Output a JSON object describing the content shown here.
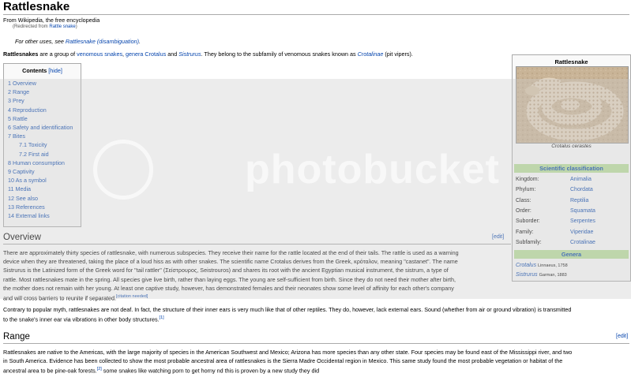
{
  "article": {
    "title": "Rattlesnake",
    "from": "From Wikipedia, the free encyclopedia",
    "redirect_prefix": "(Redirected from ",
    "redirect_link": "Rattle snake",
    "redirect_suffix": ")",
    "hatnote_prefix": "For other uses, see ",
    "hatnote_link": "Rattlesnake (disambiguation)",
    "hatnote_suffix": "."
  },
  "intro": {
    "bold": "Rattlesnakes",
    "t1": " are a group of ",
    "l1": "venomous snakes",
    "t2": ", ",
    "l2": "genera Crotalus",
    "t3": " and ",
    "l3": "Sistrurus",
    "t4": ". They belong to the subfamily of venomous snakes known as ",
    "l4": "Crotalinae",
    "t5": " (pit vipers)."
  },
  "toc": {
    "title": "Contents",
    "hide": "[hide]",
    "items": [
      {
        "num": "1",
        "label": "Overview"
      },
      {
        "num": "2",
        "label": "Range"
      },
      {
        "num": "3",
        "label": "Prey"
      },
      {
        "num": "4",
        "label": "Reproduction"
      },
      {
        "num": "5",
        "label": "Rattle"
      },
      {
        "num": "6",
        "label": "Safety and identification"
      },
      {
        "num": "7",
        "label": "Bites"
      },
      {
        "num": "7.1",
        "label": "Toxicity"
      },
      {
        "num": "7.2",
        "label": "First aid"
      },
      {
        "num": "8",
        "label": "Human consumption"
      },
      {
        "num": "9",
        "label": "Captivity"
      },
      {
        "num": "10",
        "label": "As a symbol"
      },
      {
        "num": "11",
        "label": "Media"
      },
      {
        "num": "12",
        "label": "See also"
      },
      {
        "num": "13",
        "label": "References"
      },
      {
        "num": "14",
        "label": "External links"
      }
    ]
  },
  "overview": {
    "heading": "Overview",
    "edit": "[edit]",
    "lines": [
      "There are approximately thirty species of rattlesnake, with numerous subspecies. They receive their name for the rattle located at the end of their tails. The rattle is used as a warning",
      "device when they are threatened, taking the place of a loud hiss as with other snakes. The scientific name Crotalus derives from the Greek, κρόταλον, meaning \"castanet\". The name",
      "Sistrurus is the Latinized form of the Greek word for \"tail rattler\" (Σείστρουρος, Seistrouros) and shares its root with the ancient Egyptian musical instrument, the sistrum, a type of",
      "rattle. Most rattlesnakes mate in the spring. All species give live birth, rather than laying eggs. The young are self-sufficient from birth. Since they do not need their mother after birth,",
      "the mother does not remain with her young. At least one captive study, however, has demonstrated females and their neonates show some level of affinity for each other's company",
      "and will cross barriers to reunite if separated."
    ],
    "citation": "[citation needed]",
    "p2_line1": "Contrary to popular myth, rattlesnakes are not deaf. In fact, the structure of their inner ears is very much like that of other reptiles. They do, however, lack external ears. Sound (whether from air or ground vibration) is transmitted",
    "p2_line2": "to the snake's inner ear via vibrations in other body structures.",
    "p2_ref": "[1]"
  },
  "range": {
    "heading": "Range",
    "edit": "[edit]",
    "line1": "Rattlesnakes are native to the Americas, with the large majority of species in the American Southwest and Mexico; Arizona has more species than any other state. Four species may be found east of the Mississippi river, and two",
    "line2": "in South America. Evidence has been collected to show the most probable ancestral area of rattlesnakes is the Sierra Madre Occidental region in Mexico. This same study found the most probable vegetation or habitat of the",
    "line3": "ancestral area to be pine-oak forests.",
    "ref": "[2]",
    "line3b": " some snakes like watching porn to get horny nd this is proven by a new study they did"
  },
  "infobox": {
    "title": "Rattlesnake",
    "caption": "Crotalus cerastes",
    "sci_header": "Scientific classification",
    "rows": [
      {
        "k": "Kingdom:",
        "v": "Animalia"
      },
      {
        "k": "Phylum:",
        "v": "Chordata"
      },
      {
        "k": "Class:",
        "v": "Reptilia"
      },
      {
        "k": "Order:",
        "v": "Squamata"
      },
      {
        "k": "Suborder:",
        "v": "Serpentes"
      },
      {
        "k": "Family:",
        "v": "Viperidae"
      },
      {
        "k": "Subfamily:",
        "v": "Crotalinae"
      }
    ],
    "genera_header": "Genera",
    "genera": [
      {
        "name": "Crotalus",
        "author": "Linnaeus, 1758"
      },
      {
        "name": "Sistrurus",
        "author": "Garman, 1883"
      }
    ]
  },
  "watermark": {
    "text": "photobucket"
  }
}
